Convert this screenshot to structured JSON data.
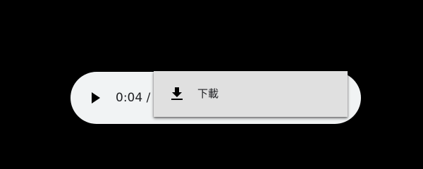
{
  "player": {
    "play_icon": "play-icon",
    "time_text": "0:04 /"
  },
  "context_menu": {
    "items": [
      {
        "icon": "download-icon",
        "label": "下載"
      }
    ]
  },
  "colors": {
    "background": "#000000",
    "player_bg": "#f1f3f4",
    "menu_bg": "#e0e0e0",
    "text": "#202124"
  }
}
